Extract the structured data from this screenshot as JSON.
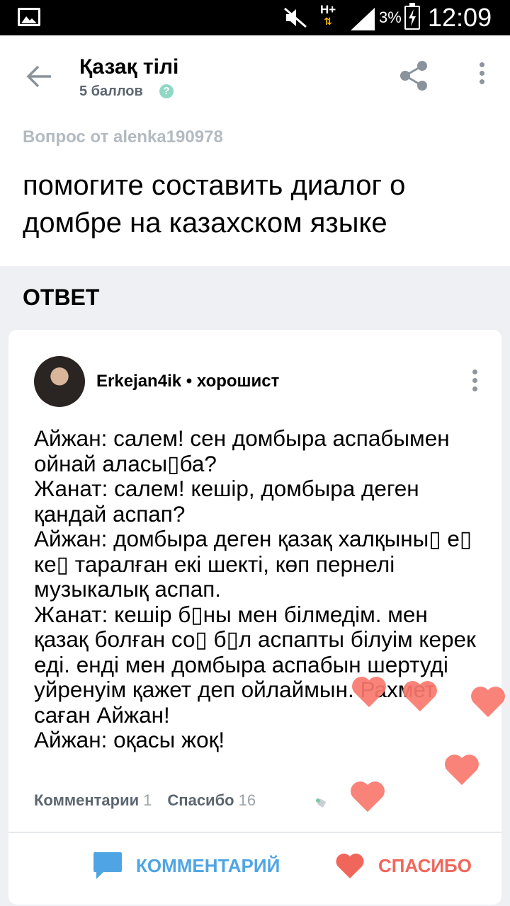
{
  "statusbar": {
    "network": "H+",
    "battery": "3%",
    "time": "12:09"
  },
  "header": {
    "subject": "Қазақ тілі",
    "points": "5 баллов",
    "help_glyph": "?",
    "question_from": "Вопрос от alenka190978",
    "question": "помогите составить диалог о домбре на казахском языке"
  },
  "answer": {
    "section_title": "ОТВЕТ",
    "author": "Erkejan4ik • хорошист",
    "text": "Айжан: салем! сен домбыра аспабымен ойнай аласы▯ба?\nЖанат: салем! кешір, домбыра деген қандай аспап?\nАйжан: домбыра деген қазақ халқыны▯ е▯ ке▯ таралған екі шекті, көп пернелі музыкалық аспап.\nЖанат: кешір б▯ны мен білмедім. мен қазақ болған со▯ б▯л аспапты білуім керек еді. енді мен домбыра аспабын шертуді уйренуім қажет деп ойлаймын. Рахмет саған Айжан!\nАйжан: оқасы жоқ!",
    "comments_label": "Комментарии",
    "comments_count": "1",
    "thanks_label": "Спасибо",
    "thanks_count": "16",
    "comment_button": "КОММЕНТАРИЙ",
    "thanks_button": "СПАСИБО"
  },
  "colors": {
    "accent_blue": "#4fa5e3",
    "accent_red": "#f1665b",
    "heart_float": "#f9786c"
  },
  "icons": [
    "back-arrow-icon",
    "share-icon",
    "more-vert-icon",
    "help-icon",
    "comment-icon",
    "heart-icon"
  ]
}
